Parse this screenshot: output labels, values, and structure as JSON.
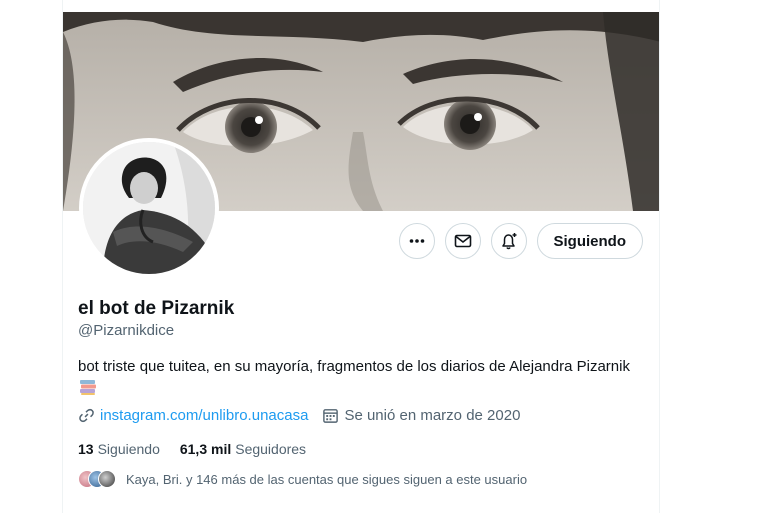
{
  "profile": {
    "name": "el bot de Pizarnik",
    "handle": "@Pizarnikdice",
    "bio": "bot triste que tuitea, en su mayoría, fragmentos de los diarios de Alejandra Pizarnik",
    "bio_emoji": "books-emoji",
    "link": "instagram.com/unlibro.unacasa",
    "joined": "Se unió en marzo de 2020",
    "following_count": "13",
    "following_label": "Siguiendo",
    "followers_count": "61,3 mil",
    "followers_label": "Seguidores",
    "followed_by": "Kaya, Bri. y 146 más de las cuentas que sigues siguen a este usuario"
  },
  "actions": {
    "more_icon": "more-icon",
    "message_icon": "envelope-icon",
    "notify_icon": "bell-plus-icon",
    "follow_label": "Siguiendo"
  },
  "icons": {
    "link": "link-icon",
    "calendar": "calendar-icon"
  },
  "colors": {
    "accent": "#1d9bf0",
    "text": "#0f1419",
    "secondary": "#536471",
    "border": "#cfd9de"
  }
}
